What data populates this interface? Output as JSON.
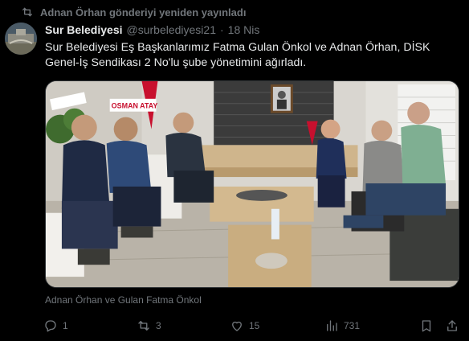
{
  "repost": {
    "icon": "repost-icon",
    "text": "Adnan Örhan gönderiyi yeniden yayınladı"
  },
  "tweet": {
    "display_name": "Sur Belediyesi",
    "handle": "@surbelediyesi21",
    "separator": "·",
    "time": "18 Nis",
    "text": "Sur Belediyesi Eş Başkanlarımız Fatma Gulan Önkol ve Adnan Örhan, DİSK Genel-İş Sendikası 2 No'lu şube yönetimini ağırladı.",
    "image_caption": "Adnan Örhan ve Gulan Fatma Önkol",
    "photo_signs": [
      "OSMAN ATAY"
    ]
  },
  "actions": {
    "reply_count": "1",
    "repost_count": "3",
    "like_count": "15",
    "views_count": "731"
  },
  "colors": {
    "background": "#000000",
    "text_primary": "#e7e9ea",
    "text_secondary": "#71767b"
  }
}
